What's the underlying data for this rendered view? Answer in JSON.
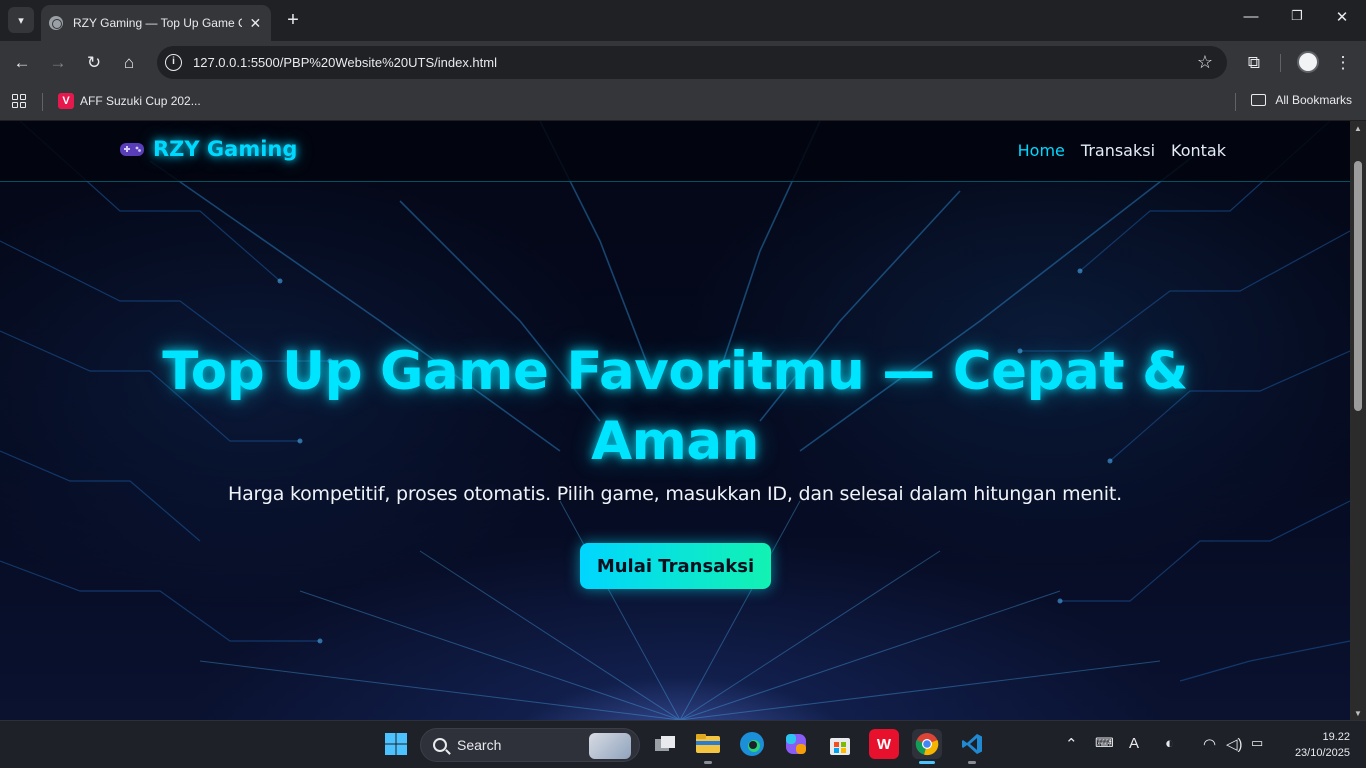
{
  "browser": {
    "tab_title": "RZY Gaming — Top Up Game Cepat & Aman",
    "url": "127.0.0.1:5500/PBP%20Website%20UTS/index.html",
    "bookmarks": [
      {
        "label": "AFF Suzuki Cup 202...",
        "favicon_letter": "V"
      }
    ],
    "all_bookmarks_label": "All Bookmarks"
  },
  "site": {
    "brand": {
      "icon": "gamepad-icon",
      "name": "RZY Gaming"
    },
    "nav": [
      {
        "label": "Home",
        "active": true
      },
      {
        "label": "Transaksi",
        "active": false
      },
      {
        "label": "Kontak",
        "active": false
      }
    ],
    "hero": {
      "title": "Top Up Game Favoritmu — Cepat & Aman",
      "subtitle": "Harga kompetitif, proses otomatis. Pilih game, masukkan ID, dan selesai dalam hitungan menit.",
      "cta_label": "Mulai Transaksi"
    },
    "colors": {
      "accent": "#00e5ff",
      "cta_start": "#00d6ff",
      "cta_end": "#12f2b2"
    }
  },
  "taskbar": {
    "search_placeholder": "Search",
    "apps": [
      "windows-start-icon",
      "task-view-icon",
      "file-explorer-icon",
      "edge-icon",
      "copilot-icon",
      "store-icon",
      "wps-icon",
      "chrome-icon",
      "vscode-icon"
    ],
    "time": "19.22",
    "date": "23/10/2025"
  }
}
